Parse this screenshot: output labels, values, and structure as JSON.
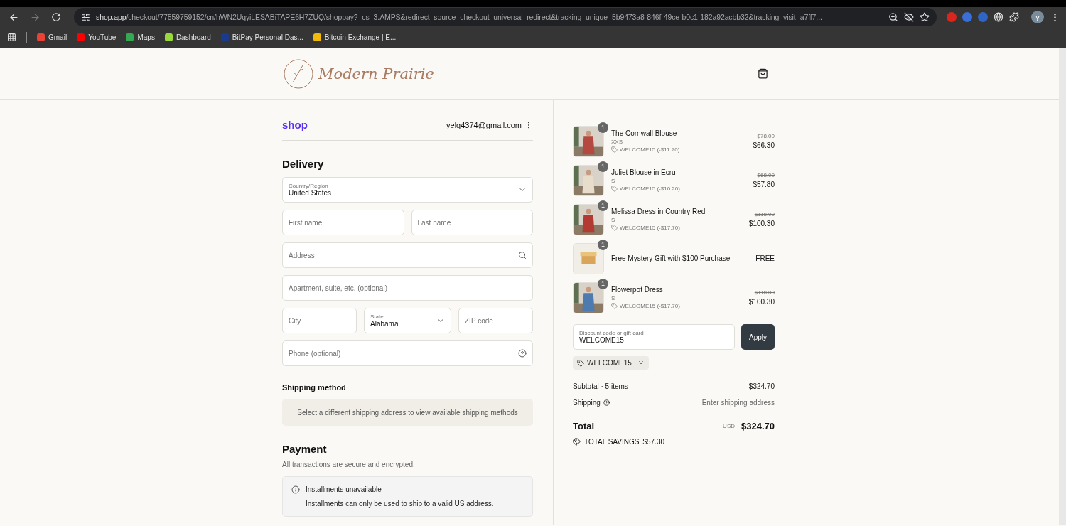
{
  "browser": {
    "url_host": "shop.app",
    "url_path": "/checkout/77559759152/cn/hWN2UqyiLESABiTAPE6H7ZUQ/shoppay?_cs=3.AMPS&redirect_source=checkout_universal_redirect&tracking_unique=5b9473a8-846f-49ce-b0c1-182a92acbb32&tracking_visit=a7ff7...",
    "forward_disabled": true,
    "avatar": "y",
    "bookmarks": [
      {
        "label": "Gmail",
        "color": "#ea4335"
      },
      {
        "label": "YouTube",
        "color": "#ff0000"
      },
      {
        "label": "Maps",
        "color": "#34a853"
      },
      {
        "label": "Dashboard",
        "color": "#9bd93a"
      },
      {
        "label": "BitPay Personal Das...",
        "color": "#1a3b8b"
      },
      {
        "label": "Bitcoin Exchange | E...",
        "color": "#f0b90b"
      }
    ]
  },
  "store": {
    "logo": "Modern Prairie"
  },
  "account": {
    "brand": "shop",
    "email": "yelq4374@gmail.com"
  },
  "delivery": {
    "title": "Delivery",
    "fields": [
      [
        {
          "kind": "select",
          "label": "Country/Region",
          "value": "United States"
        }
      ],
      [
        {
          "kind": "text",
          "placeholder": "First name"
        },
        {
          "kind": "text",
          "placeholder": "Last name"
        }
      ],
      [
        {
          "kind": "search",
          "placeholder": "Address"
        }
      ],
      [
        {
          "kind": "text",
          "placeholder": "Apartment, suite, etc. (optional)"
        }
      ],
      [
        {
          "kind": "text",
          "placeholder": "City"
        },
        {
          "kind": "select",
          "label": "State",
          "value": "Alabama"
        },
        {
          "kind": "text",
          "placeholder": "ZIP code"
        }
      ],
      [
        {
          "kind": "help",
          "placeholder": "Phone (optional)"
        }
      ]
    ]
  },
  "shipping": {
    "title": "Shipping method",
    "notice": "Select a different shipping address to view available shipping methods"
  },
  "payment": {
    "title": "Payment",
    "subtitle": "All transactions are secure and encrypted.",
    "notice_title": "Installments unavailable",
    "notice_text": "Installments can only be used to ship to a valid US address."
  },
  "cart": {
    "items": [
      {
        "name": "The Cornwall Blouse",
        "variant": "XXS",
        "discount": "WELCOME15 (-$11.70)",
        "original": "$78.00",
        "price": "$66.30",
        "qty": "1"
      },
      {
        "name": "Juliet Blouse in Ecru",
        "variant": "S",
        "discount": "WELCOME15 (-$10.20)",
        "original": "$68.00",
        "price": "$57.80",
        "qty": "1"
      },
      {
        "name": "Melissa Dress in Country Red",
        "variant": "S",
        "discount": "WELCOME15 (-$17.70)",
        "original": "$118.00",
        "price": "$100.30",
        "qty": "1"
      },
      {
        "name": "Free Mystery Gift with $100 Purchase",
        "price": "FREE",
        "qty": "1"
      },
      {
        "name": "Flowerpot Dress",
        "variant": "S",
        "discount": "WELCOME15 (-$17.70)",
        "original": "$118.00",
        "price": "$100.30",
        "qty": "1"
      }
    ],
    "discount_label": "Discount code or gift card",
    "discount_value": "WELCOME15",
    "apply": "Apply",
    "applied_code": "WELCOME15",
    "subtotal_label": "Subtotal · 5 items",
    "subtotal": "$324.70",
    "shipping_label": "Shipping",
    "shipping_value": "Enter shipping address",
    "total_label": "Total",
    "currency": "USD",
    "total": "$324.70",
    "savings_label": "TOTAL SAVINGS",
    "savings": "$57.30"
  }
}
